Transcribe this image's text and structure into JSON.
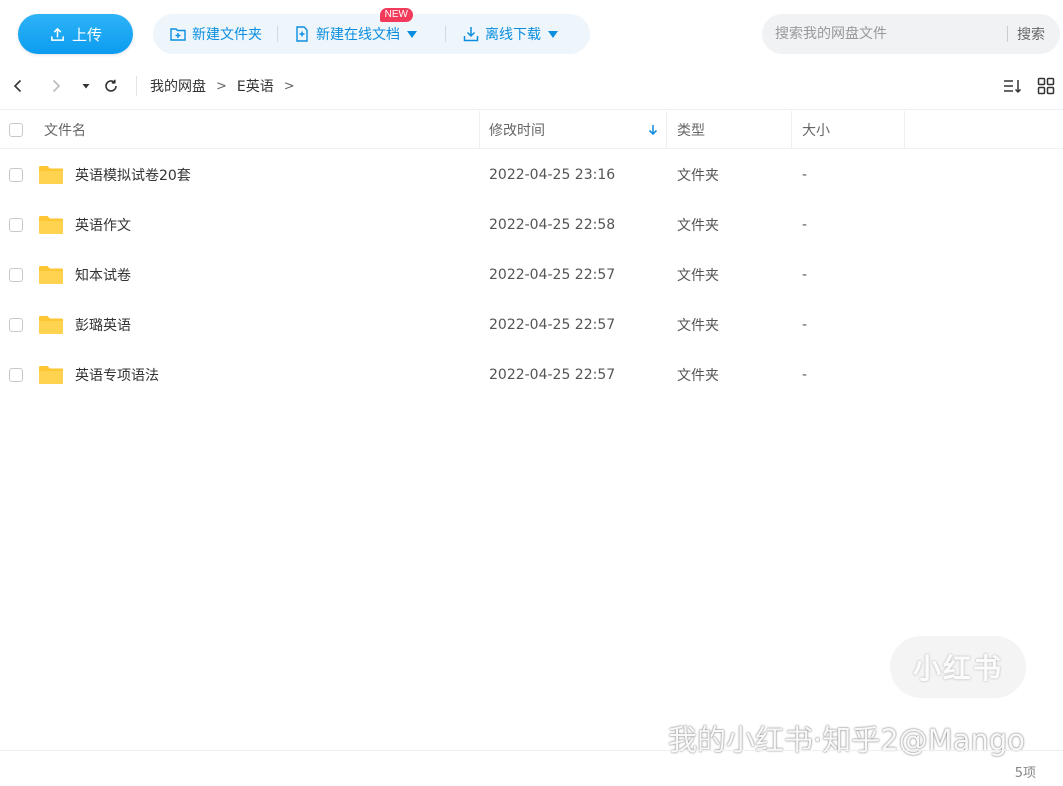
{
  "toolbar": {
    "upload_label": "上传",
    "new_folder_label": "新建文件夹",
    "new_online_doc_label": "新建在线文档",
    "new_badge": "NEW",
    "offline_download_label": "离线下载",
    "search_placeholder": "搜索我的网盘文件",
    "search_button": "搜索"
  },
  "breadcrumb": {
    "root": "我的网盘",
    "sep1": ">",
    "current": "E英语",
    "sep2": ">"
  },
  "table": {
    "headers": {
      "name": "文件名",
      "modified": "修改时间",
      "type": "类型",
      "size": "大小"
    },
    "rows": [
      {
        "name": "英语模拟试卷20套",
        "modified": "2022-04-25 23:16",
        "type": "文件夹",
        "size": "-"
      },
      {
        "name": "英语作文",
        "modified": "2022-04-25 22:58",
        "type": "文件夹",
        "size": "-"
      },
      {
        "name": "知本试卷",
        "modified": "2022-04-25 22:57",
        "type": "文件夹",
        "size": "-"
      },
      {
        "name": "彭璐英语",
        "modified": "2022-04-25 22:57",
        "type": "文件夹",
        "size": "-"
      },
      {
        "name": "英语专项语法",
        "modified": "2022-04-25 22:57",
        "type": "文件夹",
        "size": "-"
      }
    ]
  },
  "footer": {
    "item_count": "5项"
  },
  "watermark": {
    "badge": "小红书",
    "text": "我的小红书·知乎2@Mango"
  },
  "colors": {
    "accent": "#0b8ede",
    "upload_button": "#13a1f2",
    "new_badge": "#f23a5a",
    "folder": "#ffc634"
  }
}
